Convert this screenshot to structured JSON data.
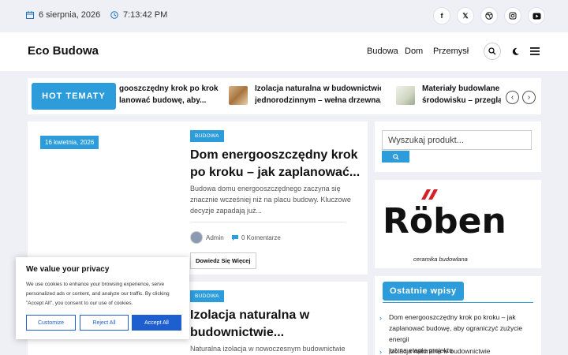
{
  "topbar": {
    "date": "6 sierpnia, 2026",
    "time": "7:13:42 PM",
    "social": [
      "facebook-icon",
      "x-icon",
      "dribbble-icon",
      "instagram-icon",
      "youtube-icon"
    ]
  },
  "header": {
    "logo": "Eco Budowa",
    "nav": [
      "Budowa",
      "Dom",
      "Przemysł"
    ]
  },
  "hot": {
    "label": "HOT TEMATY",
    "items": [
      {
        "line1": "gooszczędny krok po kroku",
        "line2": "lanować budowę, aby..."
      },
      {
        "line1": "Izolacja naturalna w budownictwie",
        "line2": "jednorodzinnym – wełna drzewna,..."
      },
      {
        "line1": "Materiały budowlane pr",
        "line2": "środowisku – przegląd"
      }
    ]
  },
  "posts": [
    {
      "date": "16 kwietnia, 2026",
      "category": "BUDOWA",
      "title_line1": "Dom energooszczędny krok",
      "title_line2": "po kroku – jak zaplanować...",
      "excerpt_line1": "Budowa domu energooszczędnego zaczyna się",
      "excerpt_line2": "znacznie wcześniej niż na placu budowy. Kluczowe",
      "excerpt_line3": "decyzje zapadają już...",
      "author": "Admin",
      "comments": "0 Komentarze",
      "readmore": "Dowiedz Się Więcej"
    },
    {
      "category": "BUDOWA",
      "title_line1": "Izolacja naturalna w",
      "title_line2": "budownictwie...",
      "excerpt_line1": "Naturalna izolacja w nowoczesnym budownictwie"
    }
  ],
  "sidebar": {
    "search_placeholder": "Wyszukaj produkt...",
    "ad_brand": "Röben",
    "ad_tagline": "ceramika budowlana",
    "recent_title": "Ostatnie wpisy",
    "recent": [
      {
        "line1": "Dom energooszczędny krok po kroku – jak",
        "line2": "zaplanować budowę, aby ograniczyć zużycie energii",
        "line3": "już na etapie projektu"
      },
      {
        "line1": "Izolacja naturalna w budownictwie"
      }
    ]
  },
  "privacy": {
    "title": "We value your privacy",
    "text_line1": "We use cookies to enhance your browsing experience, serve",
    "text_line2": "personalized ads or content, and analyze our traffic. By clicking",
    "text_line3": "\"Accept All\", you consent to our use of cookies.",
    "customize": "Customize",
    "reject": "Reject All",
    "accept": "Accept All"
  },
  "colors": {
    "accent": "#2d9cdb",
    "primary_btn": "#1e5fcf",
    "brand_red": "#d62027"
  }
}
